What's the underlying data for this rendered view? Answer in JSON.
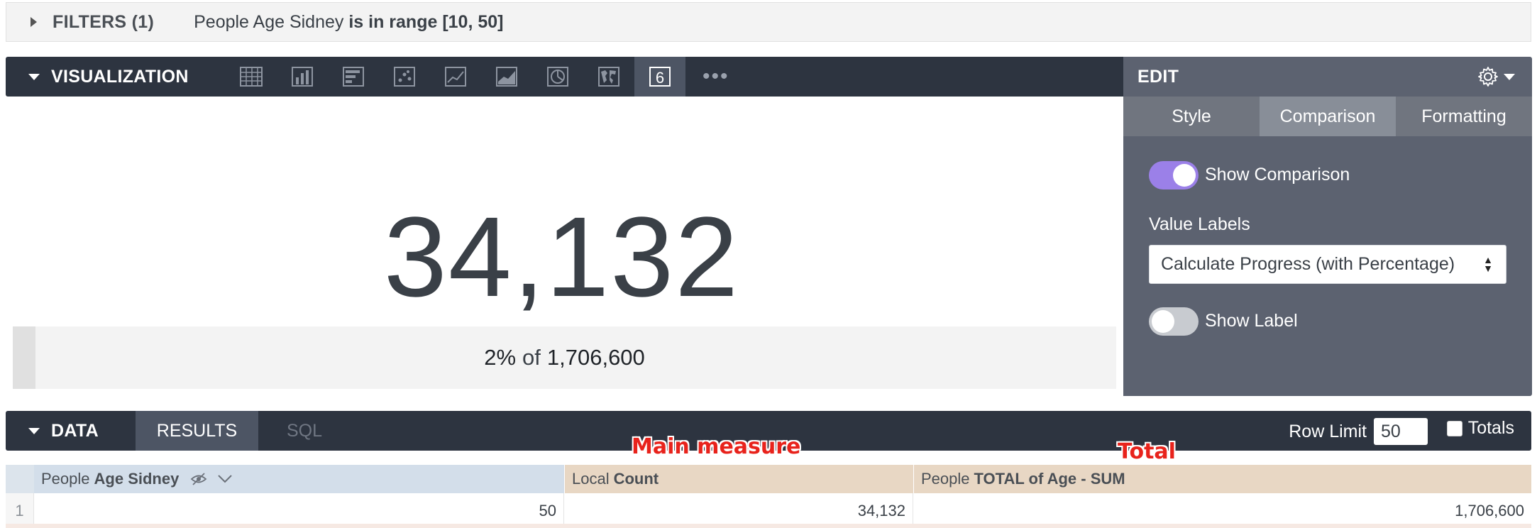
{
  "filters": {
    "title": "FILTERS (1)",
    "field": "People Age Sidney",
    "condition": "is in range [10, 50]"
  },
  "visualization": {
    "title": "VISUALIZATION",
    "icons": [
      "table-icon",
      "column-chart-icon",
      "bar-chart-icon",
      "scatter-icon",
      "line-chart-icon",
      "area-chart-icon",
      "pie-chart-icon",
      "map-icon",
      "single-value-icon"
    ],
    "single_value_icon_label": "6",
    "more": "•••",
    "value": "34,132",
    "progress": {
      "percent_label": "2%",
      "of_label": "of",
      "total_label": "1,706,600",
      "fill_fraction": 0.02
    }
  },
  "edit": {
    "title": "EDIT",
    "tabs": [
      {
        "label": "Style",
        "active": false
      },
      {
        "label": "Comparison",
        "active": true
      },
      {
        "label": "Formatting",
        "active": false
      }
    ],
    "show_comparison_label": "Show Comparison",
    "show_comparison_on": true,
    "value_labels_heading": "Value Labels",
    "value_labels_selected": "Calculate Progress (with Percentage)",
    "show_label_label": "Show Label",
    "show_label_on": false
  },
  "data": {
    "title": "DATA",
    "tabs": {
      "results": "RESULTS",
      "sql": "SQL"
    },
    "row_limit_label": "Row Limit",
    "row_limit_value": "50",
    "totals_label": "Totals",
    "columns": [
      {
        "prefix": "People",
        "name": "Age Sidney"
      },
      {
        "prefix": "Local",
        "name": "Count"
      },
      {
        "prefix": "People",
        "name": "TOTAL of Age - SUM"
      }
    ],
    "rows": [
      {
        "index": "1",
        "c1": "50",
        "c2": "34,132",
        "c3": "1,706,600"
      }
    ]
  },
  "annotations": {
    "main_measure": "Main measure",
    "total": "Total"
  },
  "colors": {
    "toolbar": "#2d3440",
    "edit_panel": "#5c6270",
    "toggle_on": "#9b80e8",
    "dimension_header": "#d3deea",
    "measure_header": "#e8d7c4",
    "annotation": "#e8231c"
  }
}
